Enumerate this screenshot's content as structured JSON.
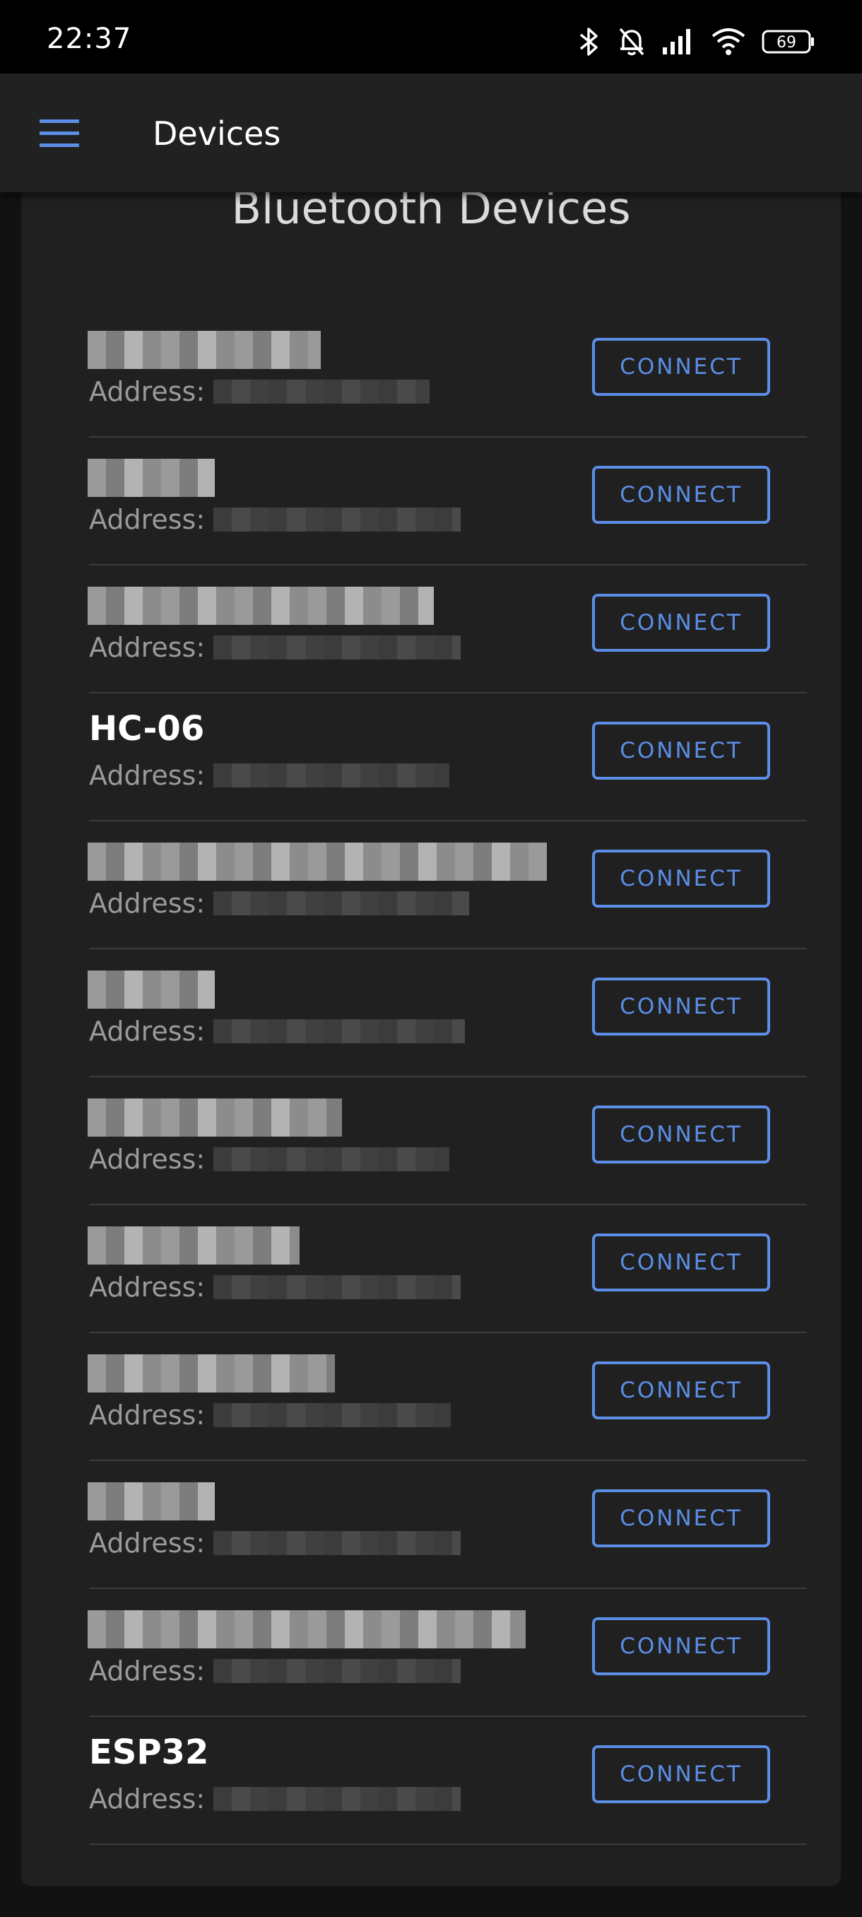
{
  "status_bar": {
    "time": "22:37",
    "battery": "69",
    "icons": [
      "bluetooth-icon",
      "bell-off-icon",
      "signal-icon",
      "wifi-icon",
      "battery-icon"
    ]
  },
  "app_bar": {
    "title": "Devices",
    "menu_icon": "hamburger-menu-icon"
  },
  "section": {
    "title": "Bluetooth Devices"
  },
  "colors": {
    "accent": "#5b8ee6",
    "background": "#121212",
    "card": "#202020"
  },
  "devices": [
    {
      "name": "",
      "address_label": "Address:",
      "button": "CONNECT",
      "redacted": true
    },
    {
      "name": "",
      "address_label": "Address:",
      "button": "CONNECT",
      "redacted": true
    },
    {
      "name": "",
      "address_label": "Address:",
      "button": "CONNECT",
      "redacted": true
    },
    {
      "name": "HC-06",
      "address_label": "Address:",
      "button": "CONNECT",
      "redacted": false
    },
    {
      "name": "",
      "address_label": "Address:",
      "button": "CONNECT",
      "redacted": true
    },
    {
      "name": "",
      "address_label": "Address:",
      "button": "CONNECT",
      "redacted": true
    },
    {
      "name": "",
      "address_label": "Address:",
      "button": "CONNECT",
      "redacted": true
    },
    {
      "name": "",
      "address_label": "Address:",
      "button": "CONNECT",
      "redacted": true
    },
    {
      "name": "",
      "address_label": "Address:",
      "button": "CONNECT",
      "redacted": true
    },
    {
      "name": "",
      "address_label": "Address:",
      "button": "CONNECT",
      "redacted": true
    },
    {
      "name": "",
      "address_label": "Address:",
      "button": "CONNECT",
      "redacted": true
    },
    {
      "name": "ESP32",
      "address_label": "Address:",
      "button": "CONNECT",
      "redacted": false
    }
  ]
}
